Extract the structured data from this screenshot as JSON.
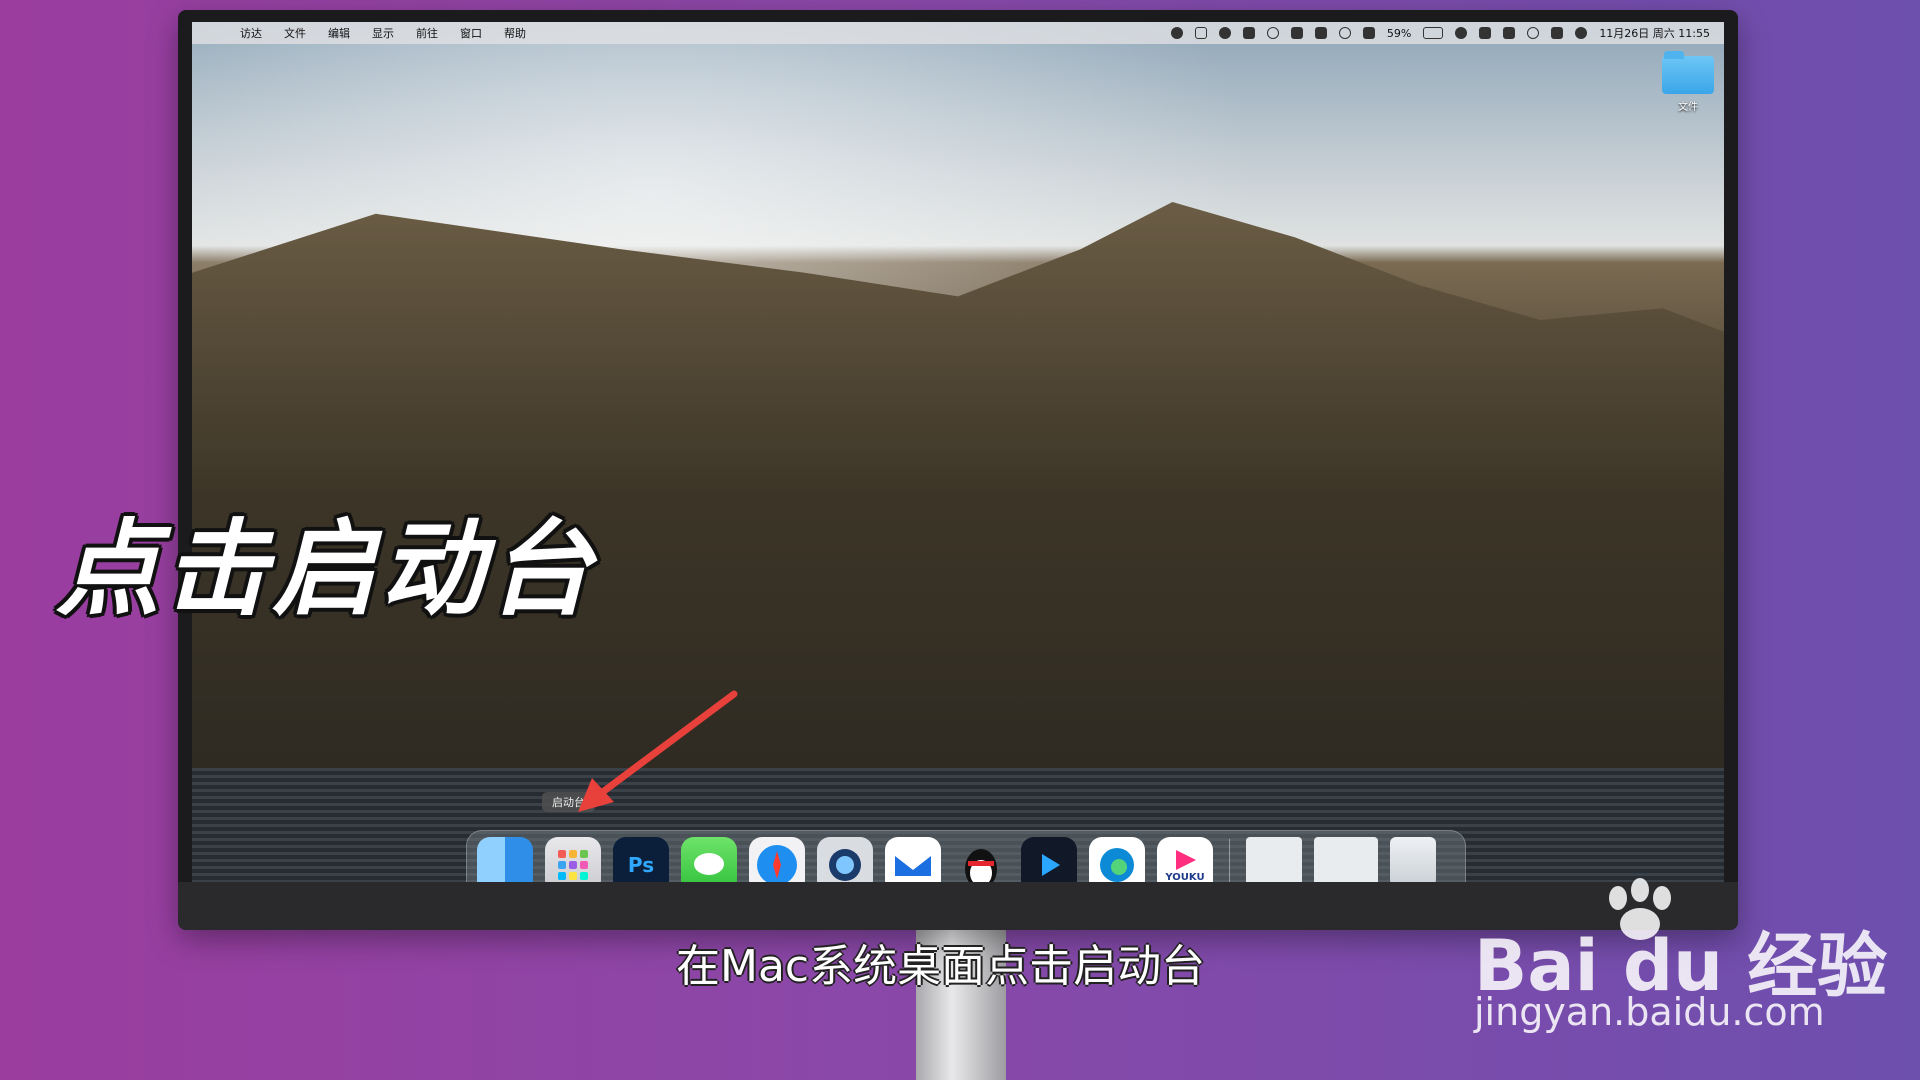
{
  "menubar": {
    "items": [
      "访达",
      "文件",
      "编辑",
      "显示",
      "前往",
      "窗口",
      "帮助"
    ],
    "battery": "59%",
    "datetime": "11月26日 周六  11:55"
  },
  "desktop": {
    "folder_label": "文件"
  },
  "dock": {
    "tooltip": "启动台",
    "apps": [
      {
        "name": "finder-icon",
        "label": ""
      },
      {
        "name": "launchpad-icon",
        "label": ""
      },
      {
        "name": "photoshop-icon",
        "label": "Ps"
      },
      {
        "name": "messages-icon",
        "label": ""
      },
      {
        "name": "safari-icon",
        "label": ""
      },
      {
        "name": "quicktime-icon",
        "label": ""
      },
      {
        "name": "mail-icon",
        "label": ""
      },
      {
        "name": "qq-icon",
        "label": ""
      },
      {
        "name": "video-player-icon",
        "label": ""
      },
      {
        "name": "edge-icon",
        "label": ""
      },
      {
        "name": "youku-icon",
        "label": "YOUKU"
      }
    ]
  },
  "overlay": {
    "title": "点击启动台",
    "subtitle": "在Mac系统桌面点击启动台"
  },
  "watermark": {
    "logo": "Bai du 经验",
    "url": "jingyan.baidu.com"
  },
  "colors": {
    "arrow": "#e8403a"
  }
}
